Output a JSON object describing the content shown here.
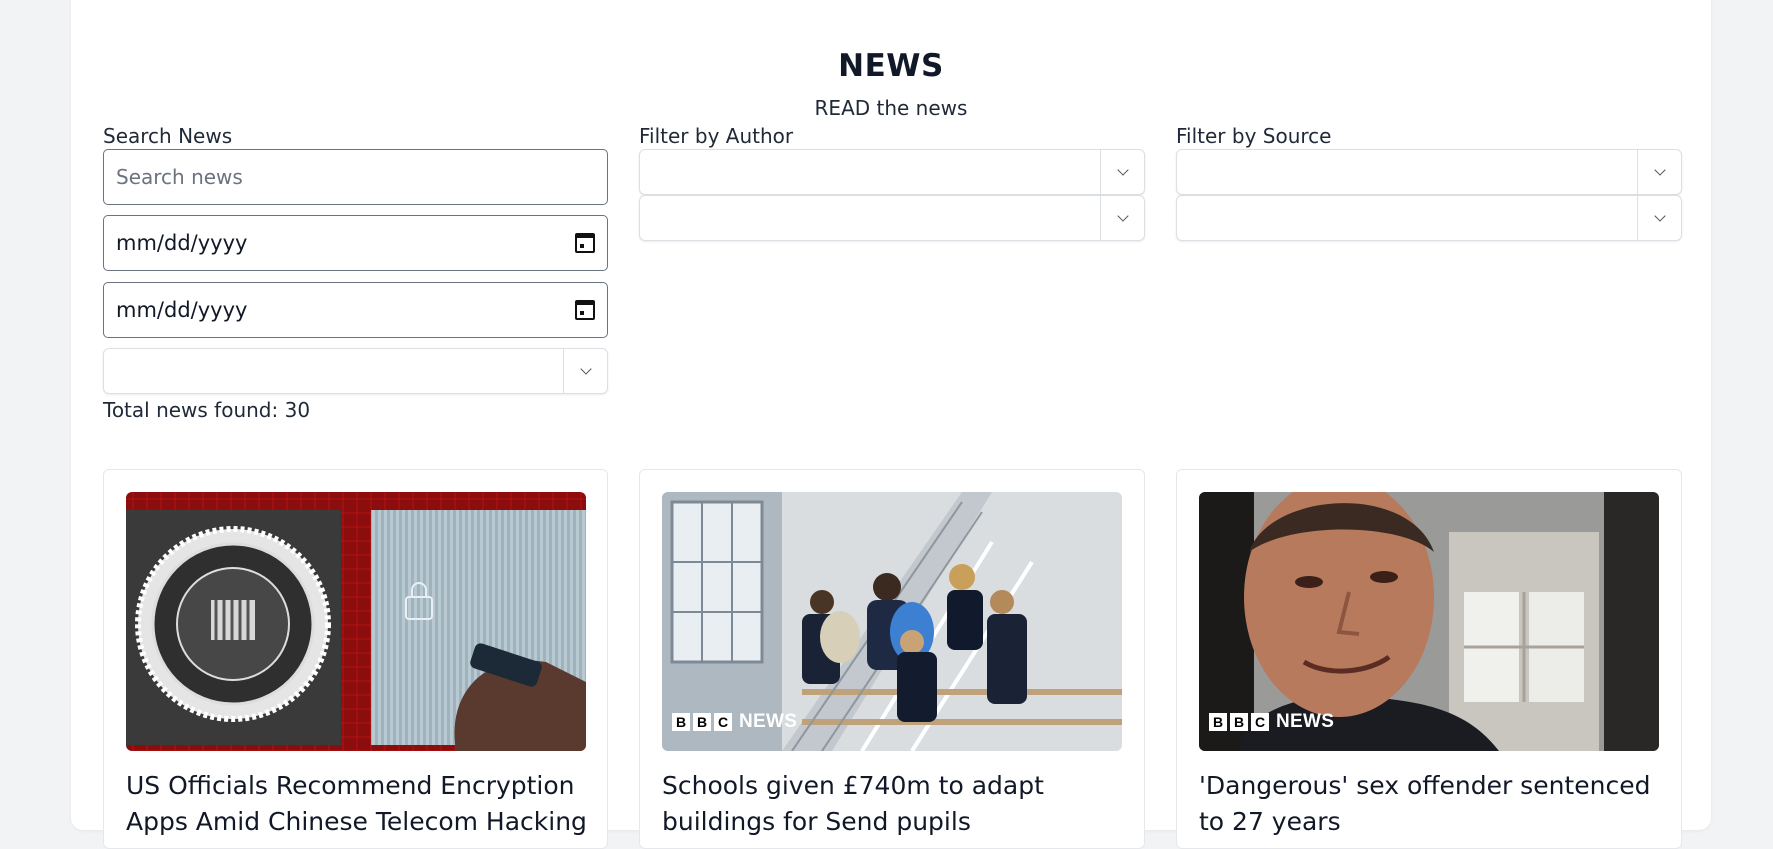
{
  "header": {
    "title": "NEWS",
    "subtitle": "READ the news"
  },
  "filters": {
    "search_label": "Search News",
    "search_placeholder": "Search news",
    "search_value": "",
    "date_from": "mm/dd/yyyy",
    "date_to": "mm/dd/yyyy",
    "extra_select_value": "",
    "author_label": "Filter by Author",
    "author_select_1": "",
    "author_select_2": "",
    "source_label": "Filter by Source",
    "source_select_1": "",
    "source_select_2": ""
  },
  "results": {
    "total_text": "Total news found: 30"
  },
  "articles": [
    {
      "title": "US Officials Recommend Encryption Apps Amid Chinese Telecom Hacking",
      "image": "fbi-seal-phone-photo",
      "badge": ""
    },
    {
      "title": "Schools given £740m to adapt buildings for Send pupils",
      "image": "students-on-stairs-photo",
      "badge": "NEWS"
    },
    {
      "title": "'Dangerous' sex offender sentenced to 27 years",
      "image": "man-selfie-photo",
      "badge": "NEWS"
    }
  ],
  "bbc_letters": [
    "B",
    "B",
    "C"
  ],
  "colors": {
    "page_bg": "#f2f3f5",
    "panel_bg": "#ffffff",
    "text": "#111827",
    "input_border": "#6b7280"
  }
}
